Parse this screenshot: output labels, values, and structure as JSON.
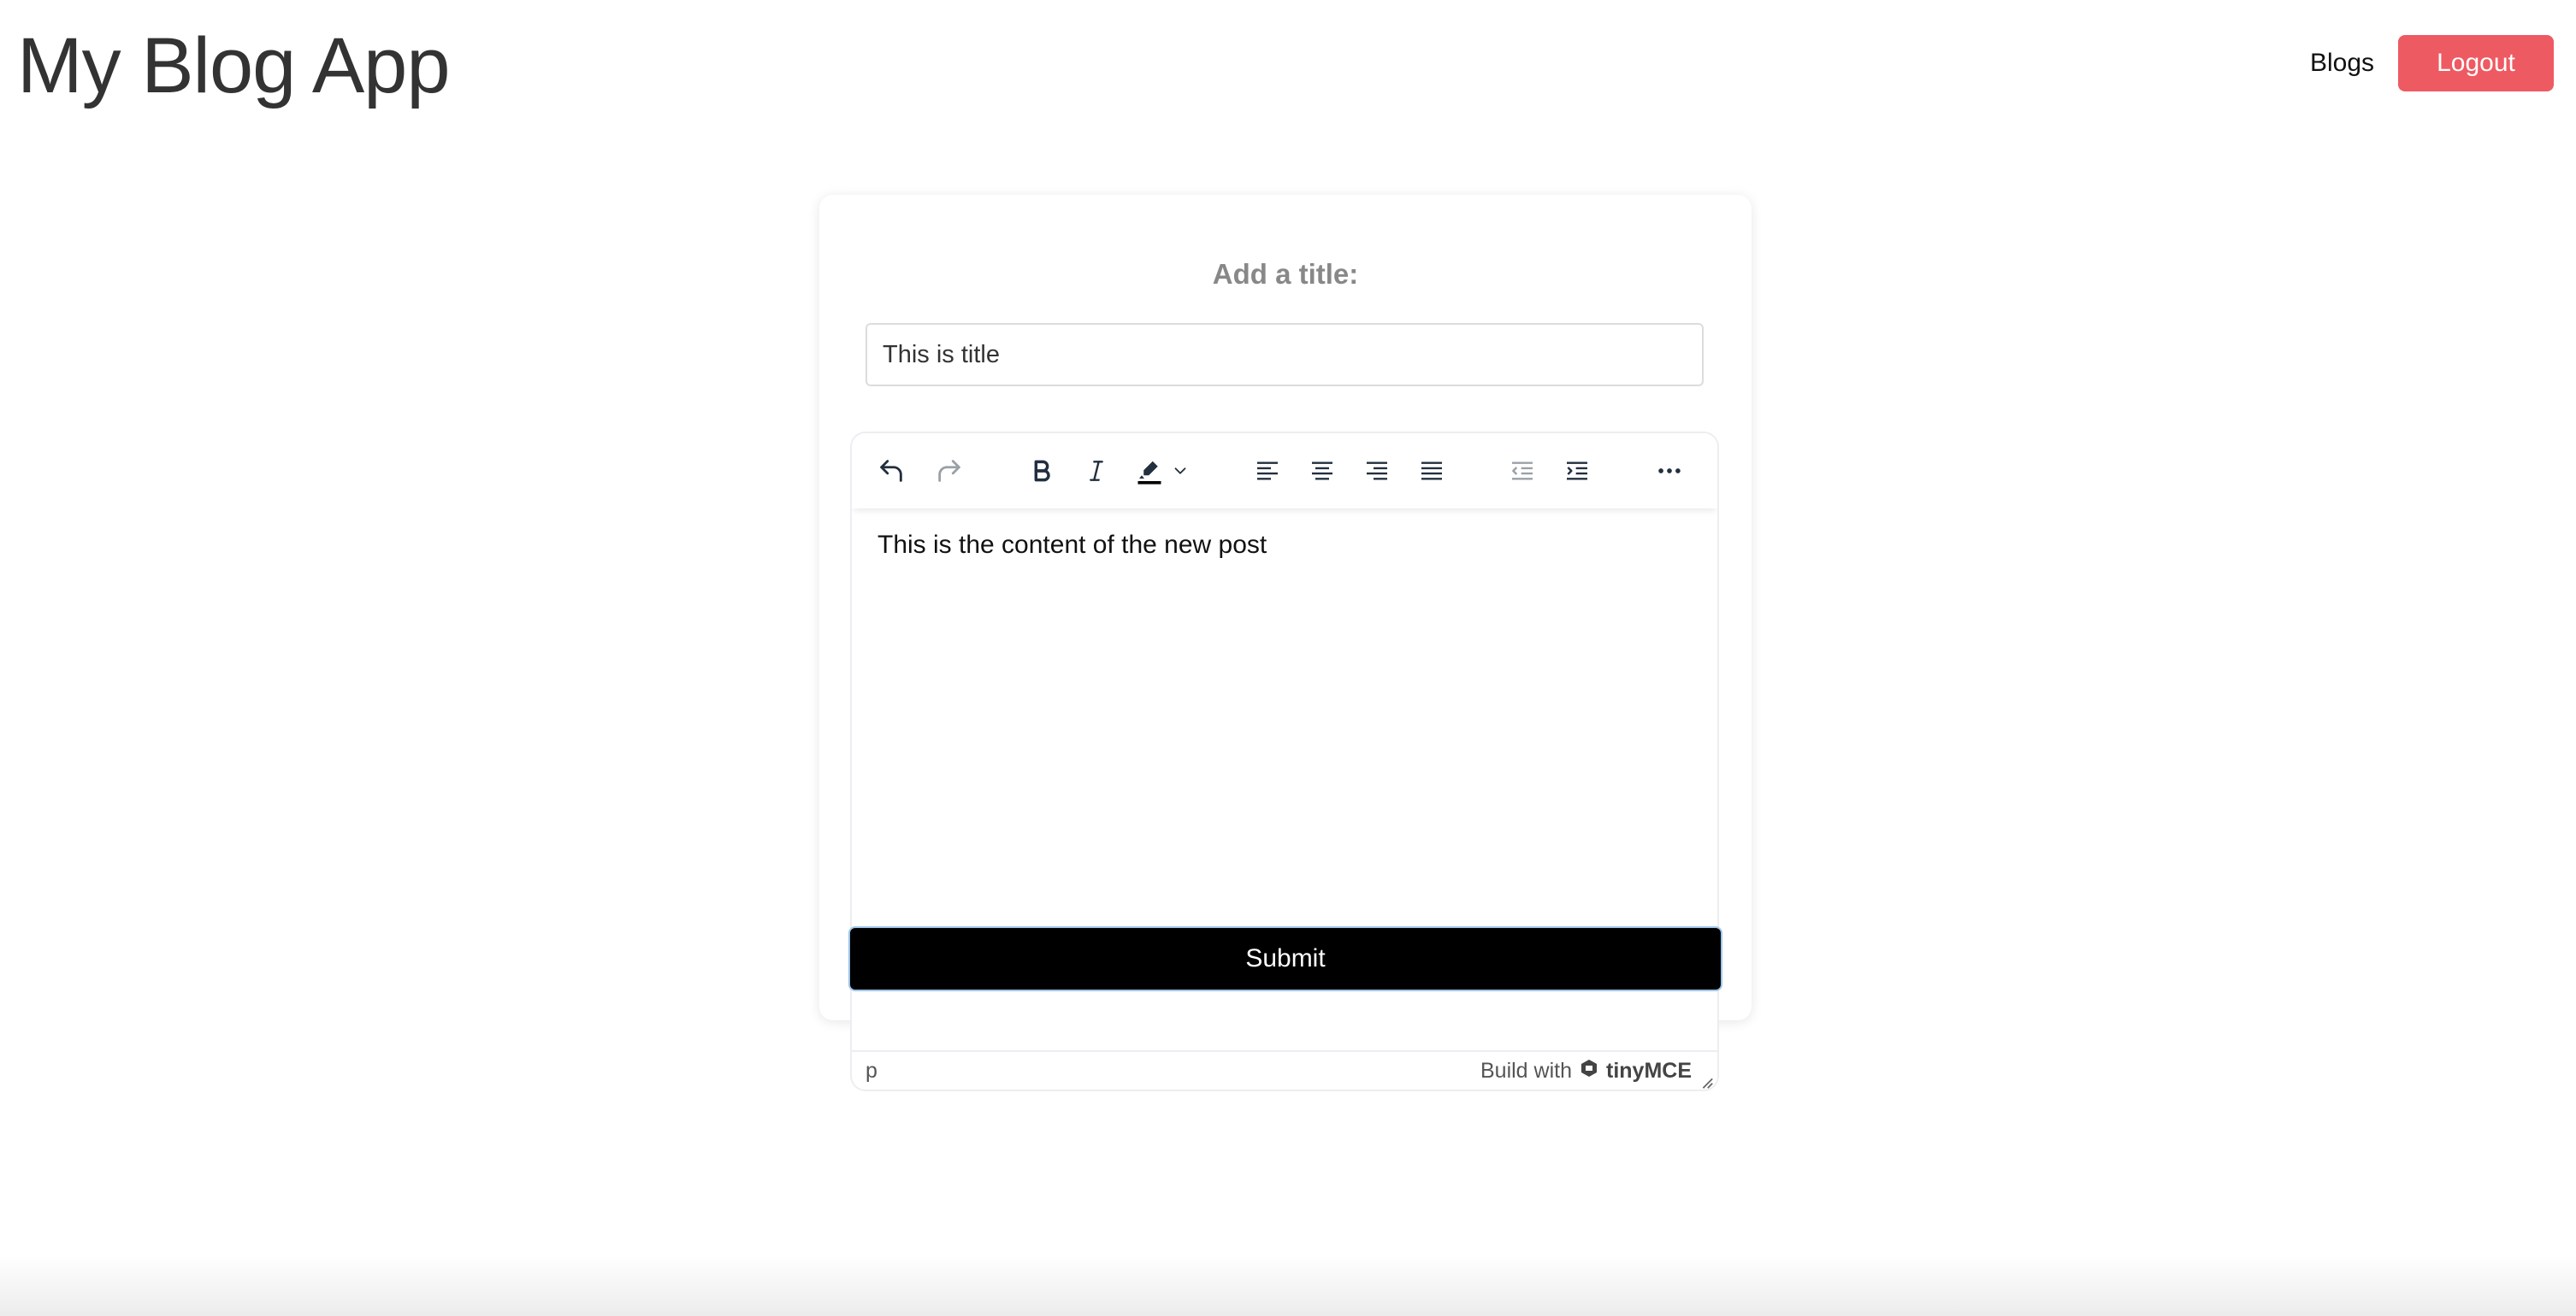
{
  "header": {
    "app_title": "My Blog App",
    "nav": {
      "blogs_label": "Blogs",
      "logout_label": "Logout"
    }
  },
  "form": {
    "title_label": "Add a title:",
    "title_value": "This is title",
    "editor": {
      "toolbar": [
        {
          "name": "undo-icon"
        },
        {
          "name": "redo-icon"
        },
        {
          "name": "bold-icon"
        },
        {
          "name": "italic-icon"
        },
        {
          "name": "highlight-icon"
        },
        {
          "name": "chevron-down-icon"
        },
        {
          "name": "align-left-icon"
        },
        {
          "name": "align-center-icon"
        },
        {
          "name": "align-right-icon"
        },
        {
          "name": "align-justify-icon"
        },
        {
          "name": "outdent-icon"
        },
        {
          "name": "indent-icon"
        },
        {
          "name": "more-icon"
        }
      ],
      "content": "This is the content of the new post",
      "status_path": "p",
      "branding_prefix": "Build with",
      "branding_name": "tinyMCE"
    },
    "submit_label": "Submit"
  },
  "colors": {
    "logout_bg": "#ee5a62",
    "submit_bg": "#000000",
    "icon_color": "#222f3e"
  }
}
